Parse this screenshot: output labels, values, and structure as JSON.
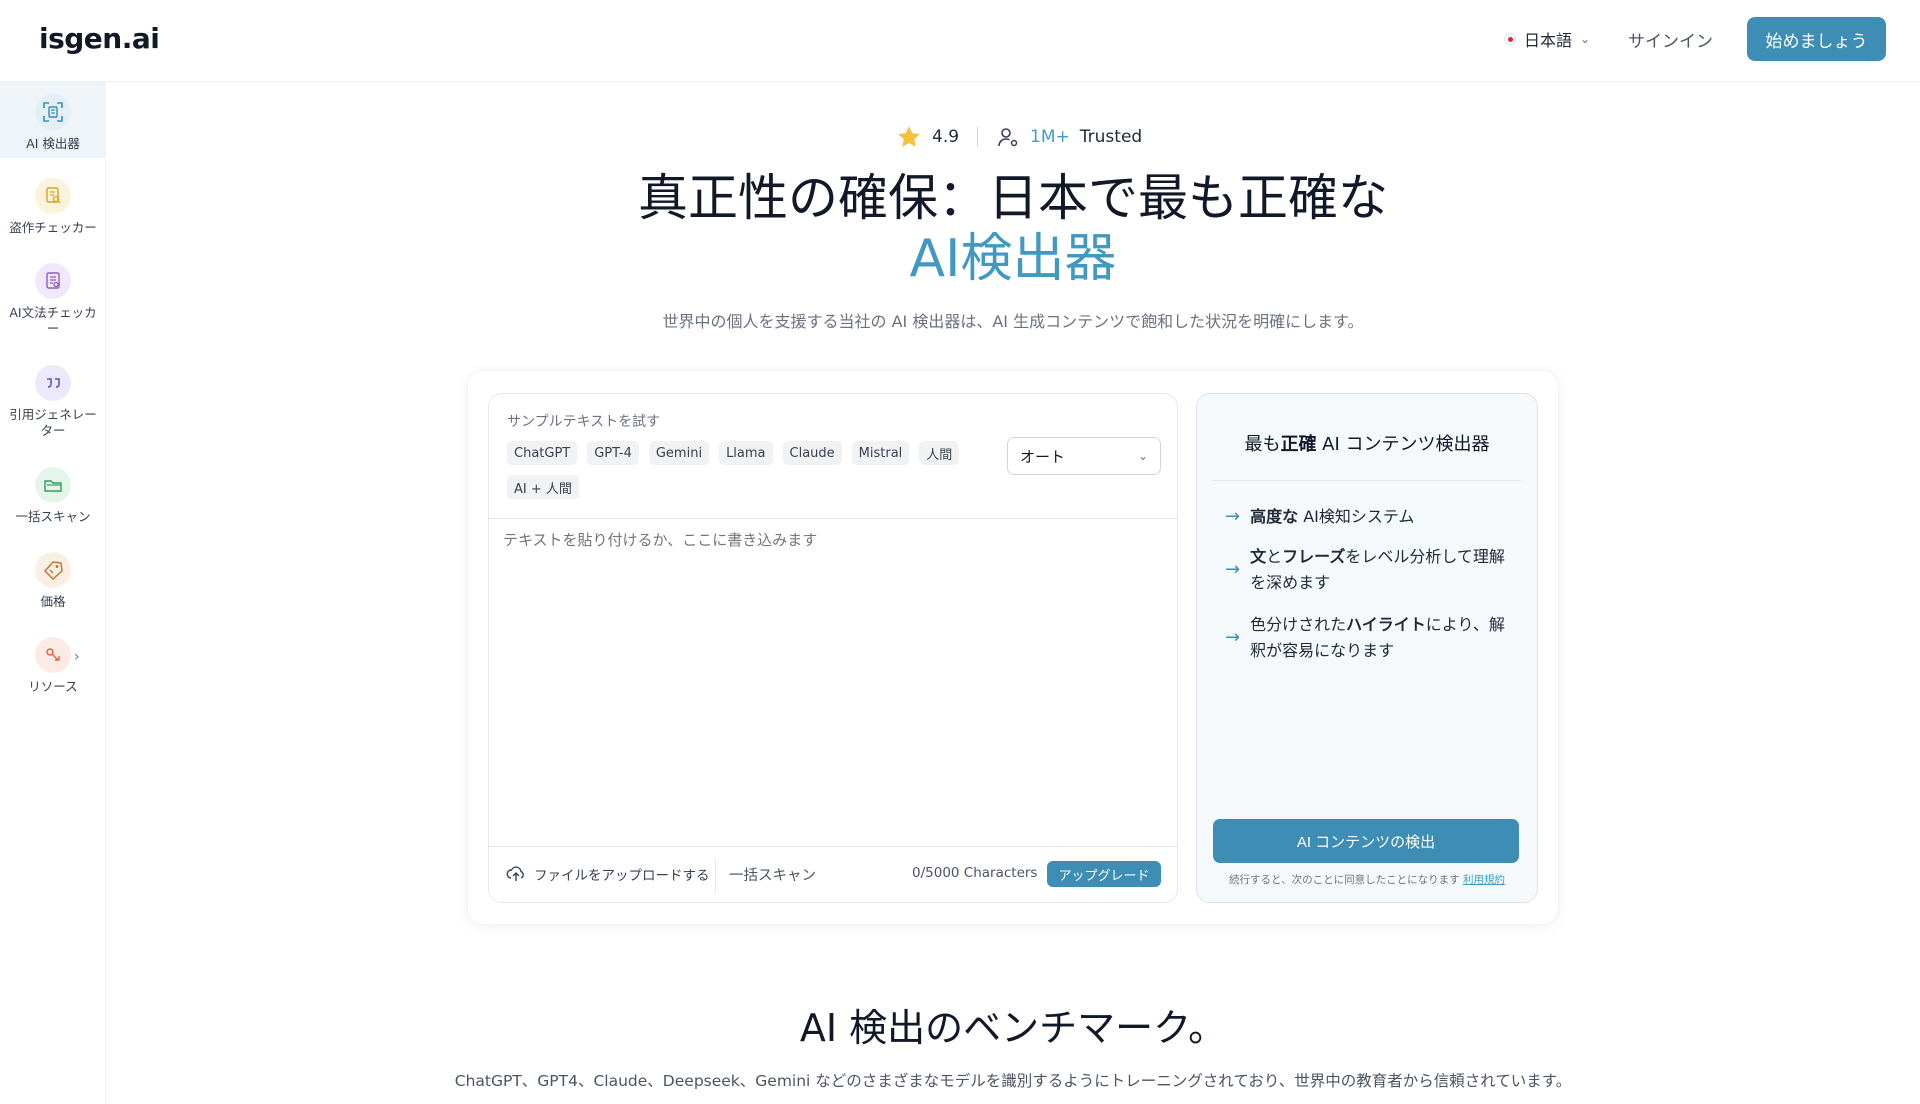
{
  "header": {
    "logo": "isgen.ai",
    "language": "日本語",
    "signin": "サインイン",
    "start": "始めましょう"
  },
  "sidebar": {
    "items": [
      {
        "label": "AI 検出器",
        "icon": "ai-scan-icon",
        "color": "#3d8db5",
        "active": true
      },
      {
        "label": "盗作チェッカー",
        "icon": "document-search-icon",
        "color": "#d8a31d"
      },
      {
        "label": "AI文法チェッカー",
        "icon": "grammar-doc-icon",
        "color": "#8b5cc7"
      },
      {
        "label": "引用ジェネレーター",
        "icon": "quote-icon",
        "color": "#5b55c9"
      },
      {
        "label": "一括スキャン",
        "icon": "folder-icon",
        "color": "#2f9e5b"
      },
      {
        "label": "価格",
        "icon": "price-tag-icon",
        "color": "#c0792a"
      },
      {
        "label": "リソース",
        "icon": "resources-icon",
        "color": "#e0623a"
      }
    ]
  },
  "hero": {
    "rating": "4.9",
    "users_count": "1M+",
    "users_label": "Trusted",
    "title_line1": "真正性の確保：日本で最も正確な",
    "title_line2": "AI検出器",
    "subtitle": "世界中の個人を支援する当社の AI 検出器は、AI 生成コンテンツで飽和した状況を明確にします。"
  },
  "editor": {
    "sample_label": "サンプルテキストを試す",
    "chips": [
      "ChatGPT",
      "GPT-4",
      "Gemini",
      "Llama",
      "Claude",
      "Mistral",
      "人間",
      "AI + 人間"
    ],
    "mode": "オート",
    "placeholder": "テキストを貼り付けるか、ここに書き込みます",
    "upload": "ファイルをアップロードする",
    "bulk": "一括スキャン",
    "chars": "0/5000 Characters",
    "upgrade": "アップグレード"
  },
  "panel": {
    "title_pre": "最も",
    "title_bold": "正確",
    "title_post": " AI コンテンツ検出器",
    "features": [
      {
        "bold": "高度な",
        "text": " AI検知システム"
      },
      {
        "bold": "文",
        "text": "と",
        "bold2": "フレーズ",
        "text2": "をレベル分析して理解を深めます"
      },
      {
        "text": "色分けされた",
        "bold": "ハイライト",
        "text2": "により、解釈が容易になります"
      }
    ],
    "detect": "AI コンテンツの検出",
    "terms_text": "続行すると、次のことに同意したことになります",
    "terms_link": "利用規約"
  },
  "bench": {
    "title": "AI 検出のベンチマーク。",
    "subtitle": "ChatGPT、GPT4、Claude、Deepseek、Gemini などのさまざまなモデルを識別するようにトレーニングされており、世界中の教育者から信頼されています。"
  }
}
